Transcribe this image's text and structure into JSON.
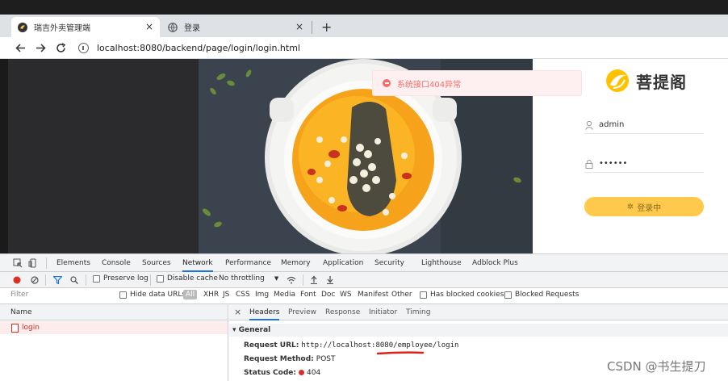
{
  "browser": {
    "tabs": [
      {
        "label": "瑞吉外卖管理端",
        "active": true
      },
      {
        "label": "登录",
        "active": false
      }
    ],
    "new_tab": "+",
    "url": "localhost:8080/backend/page/login/login.html"
  },
  "page": {
    "toast_message": "系统接口404异常",
    "logo_text": "菩提阁",
    "username": "admin",
    "password": "••••••",
    "login_button": "登录中"
  },
  "devtools": {
    "tabs": [
      "Elements",
      "Console",
      "Sources",
      "Network",
      "Performance",
      "Memory",
      "Application",
      "Security",
      "Lighthouse",
      "Adblock Plus"
    ],
    "active_tab": "Network",
    "toolbar": {
      "preserve_log": "Preserve log",
      "disable_cache": "Disable cache",
      "throttling": "No throttling"
    },
    "filter": {
      "placeholder": "Filter",
      "hide_data_urls": "Hide data URLs",
      "types": [
        "All",
        "XHR",
        "JS",
        "CSS",
        "Img",
        "Media",
        "Font",
        "Doc",
        "WS",
        "Manifest",
        "Other"
      ],
      "has_blocked_cookies": "Has blocked cookies",
      "blocked_requests": "Blocked Requests"
    },
    "request_list": {
      "header": "Name",
      "rows": [
        "login"
      ]
    },
    "detail": {
      "close": "×",
      "tabs": [
        "Headers",
        "Preview",
        "Response",
        "Initiator",
        "Timing"
      ],
      "active_tab": "Headers",
      "section": "▾ General",
      "request_url_label": "Request URL:",
      "request_url": "http://localhost:8080/employee/login",
      "request_method_label": "Request Method:",
      "request_method": "POST",
      "status_code_label": "Status Code:",
      "status_code": "404"
    }
  },
  "watermark": "CSDN @书生提刀",
  "colors": {
    "accent": "#ffc94d",
    "error": "#f56c6c",
    "devtools_blue": "#1a73e8",
    "annotation_red": "#e0201a"
  }
}
